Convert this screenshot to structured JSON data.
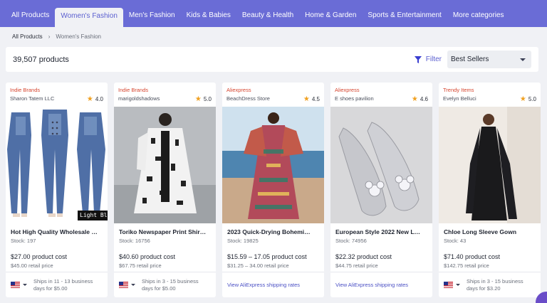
{
  "nav": {
    "tabs": [
      {
        "label": "All Products"
      },
      {
        "label": "Women's Fashion"
      },
      {
        "label": "Men's Fashion"
      },
      {
        "label": "Kids & Babies"
      },
      {
        "label": "Beauty & Health"
      },
      {
        "label": "Home & Garden"
      },
      {
        "label": "Sports & Entertainment"
      },
      {
        "label": "More categories"
      }
    ],
    "active_index": 1
  },
  "breadcrumb": {
    "root": "All Products",
    "current": "Women's Fashion"
  },
  "toolbar": {
    "count": "39,507 products",
    "filter_label": "Filter",
    "sort_value": "Best Sellers"
  },
  "products": [
    {
      "brand": "Indie Brands",
      "seller": "Sharon Tatem LLC",
      "rating": "4.0",
      "title": "Hot High Quality Wholesale …",
      "stock": "Stock: 197",
      "cost": "$27.00 product cost",
      "retail": "$45.00 retail price",
      "ship_text_1": "Ships in 11 - 13 business",
      "ship_text_2": "days for $5.00",
      "image_caption": "Light Bl"
    },
    {
      "brand": "Indie Brands",
      "seller": "marigoldshadows",
      "rating": "5.0",
      "title": "Toriko Newspaper Print Shir…",
      "stock": "Stock: 16756",
      "cost": "$40.60 product cost",
      "retail": "$67.75 retail price",
      "ship_text_1": "Ships in 3 - 15 business",
      "ship_text_2": "days for $5.00"
    },
    {
      "brand": "Aliexpress",
      "seller": "BeachDress Store",
      "rating": "4.5",
      "title": "2023 Quick-Drying Bohemi…",
      "stock": "Stock: 19825",
      "cost": "$15.59 – 17.05 product cost",
      "retail": "$31.25 – 34.00 retail price",
      "ship_link": "View AliExpress shipping rates"
    },
    {
      "brand": "Aliexpress",
      "seller": "E shoes pavilion",
      "rating": "4.6",
      "title": "European Style 2022 New L…",
      "stock": "Stock: 74956",
      "cost": "$22.32 product cost",
      "retail": "$44.75 retail price",
      "ship_link": "View AliExpress shipping rates"
    },
    {
      "brand": "Trendy Items",
      "seller": "Evelyn Belluci",
      "rating": "5.0",
      "title": "Chloe Long Sleeve Gown",
      "stock": "Stock: 43",
      "cost": "$71.40 product cost",
      "retail": "$142.75 retail price",
      "ship_text_1": "Ships in 3 - 15 business",
      "ship_text_2": "days for $3.20"
    }
  ],
  "colors": {
    "nav_bg": "#6a6cd6",
    "accent": "#5b5fd0",
    "brand_red": "#d6452f",
    "star": "#f0a020"
  }
}
